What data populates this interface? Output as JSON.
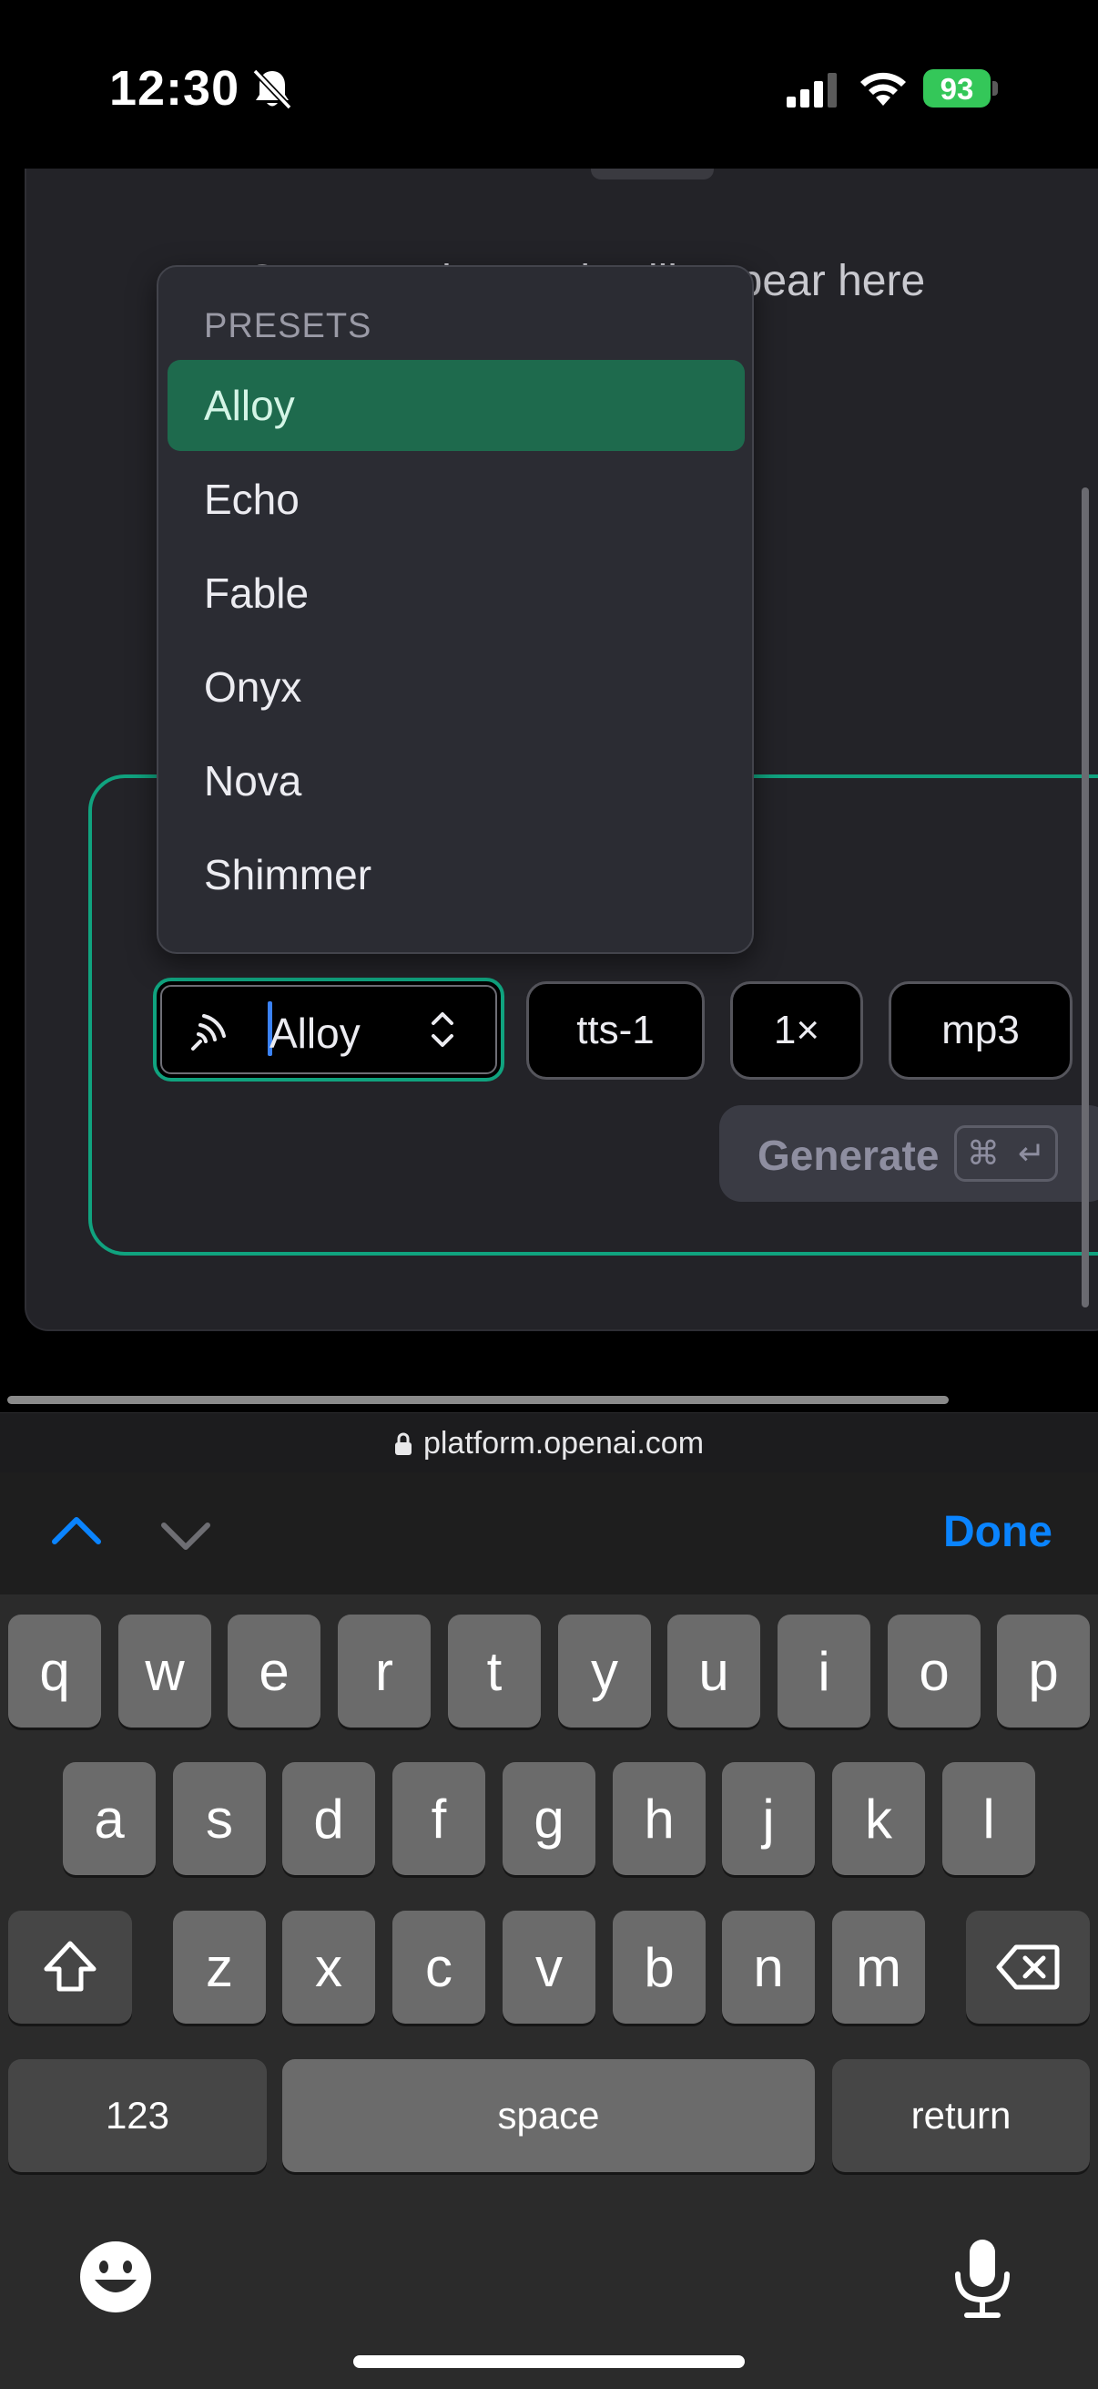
{
  "status_bar": {
    "time": "12:30",
    "battery": "93",
    "icons": [
      "bell-slash-icon",
      "cellular-signal-icon",
      "wifi-icon",
      "battery-charging-icon"
    ]
  },
  "page": {
    "placeholder": "Generated speech will appear here",
    "voice_select": {
      "value": "Alloy",
      "icon": "voice-waves-icon"
    },
    "model_pill": "tts-1",
    "speed_pill": "1×",
    "format_pill": "mp3",
    "generate": {
      "label": "Generate",
      "shortcut_cmd": "⌘",
      "shortcut_enter": "↵"
    }
  },
  "menu": {
    "header": "PRESETS",
    "items": [
      "Alloy",
      "Echo",
      "Fable",
      "Onyx",
      "Nova",
      "Shimmer"
    ],
    "selected": "Alloy"
  },
  "safari": {
    "url": "platform.openai.com"
  },
  "accessory": {
    "done_label": "Done"
  },
  "keyboard": {
    "row1": [
      "q",
      "w",
      "e",
      "r",
      "t",
      "y",
      "u",
      "i",
      "o",
      "p"
    ],
    "row2": [
      "a",
      "s",
      "d",
      "f",
      "g",
      "h",
      "j",
      "k",
      "l"
    ],
    "row3": [
      "z",
      "x",
      "c",
      "v",
      "b",
      "n",
      "m"
    ],
    "numbers_label": "123",
    "space_label": "space",
    "return_label": "return"
  },
  "colors": {
    "accent_green": "#10a37f",
    "selected_item_bg": "#1e6a4d",
    "ios_blue": "#0a84ff",
    "battery_green": "#34c759"
  }
}
